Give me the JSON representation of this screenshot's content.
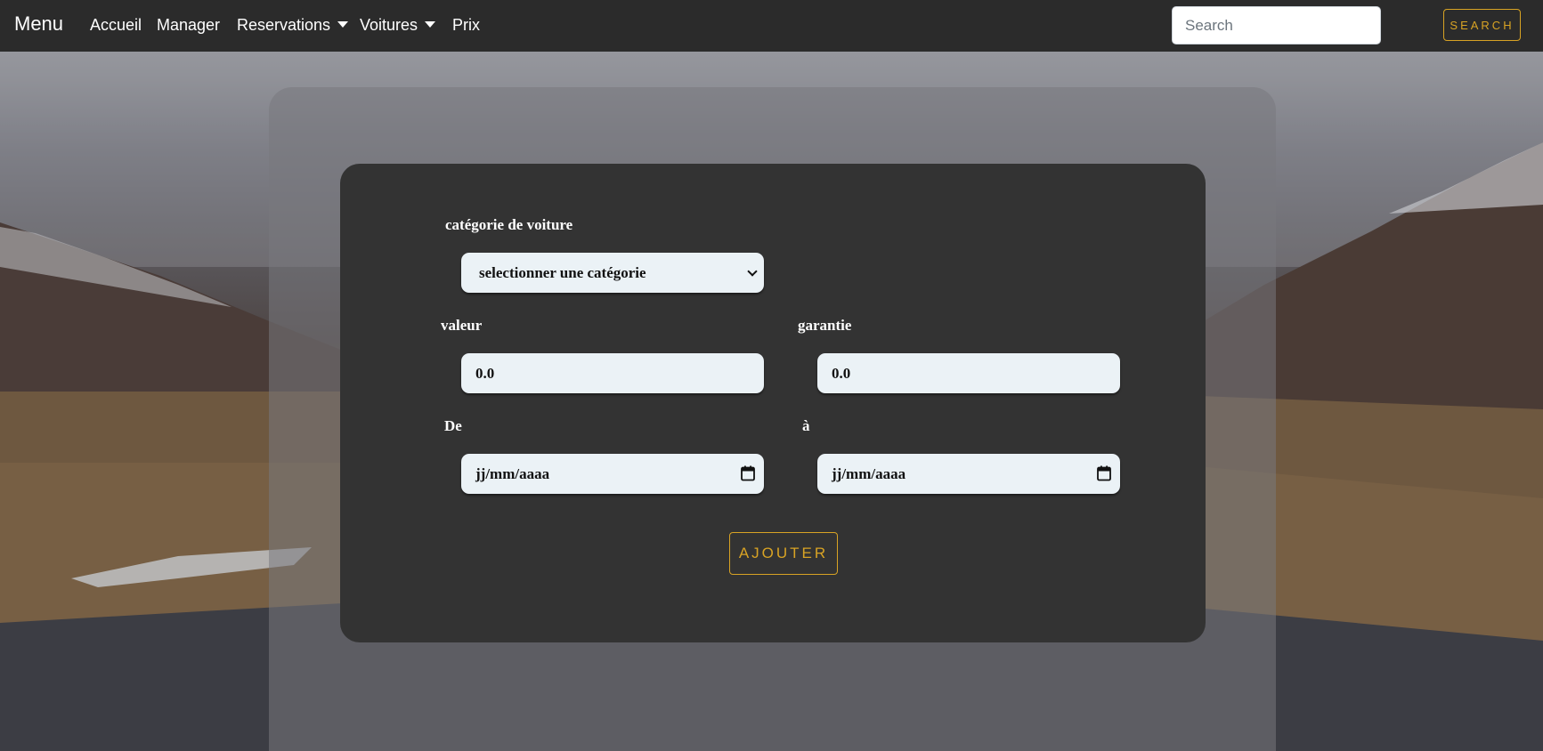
{
  "navbar": {
    "brand": "Menu",
    "links": [
      {
        "label": "Accueil"
      },
      {
        "label": "Manager"
      },
      {
        "label": "Reservations"
      },
      {
        "label": "Voitures"
      },
      {
        "label": "Prix"
      }
    ],
    "search_placeholder": "Search",
    "search_button": "SEARCH"
  },
  "form": {
    "category_label": "catégorie de voiture",
    "category_select": "selectionner une catégorie",
    "valeur_label": "valeur",
    "valeur_value": "0.0",
    "garantie_label": "garantie",
    "garantie_value": "0.0",
    "de_label": "De",
    "de_placeholder": "jj/mm/aaaa",
    "a_label": "à",
    "a_placeholder": "jj/mm/aaaa",
    "submit_label": "AJOUTER"
  },
  "colors": {
    "navbar_bg": "#2b2b2b",
    "accent": "#d8a324",
    "card_bg": "#333333",
    "field_bg": "#ebf2f6"
  },
  "icons": {
    "dropdown_caret": "caret-down-icon",
    "select_chevron": "chevron-down-icon",
    "date_picker": "calendar-icon"
  }
}
